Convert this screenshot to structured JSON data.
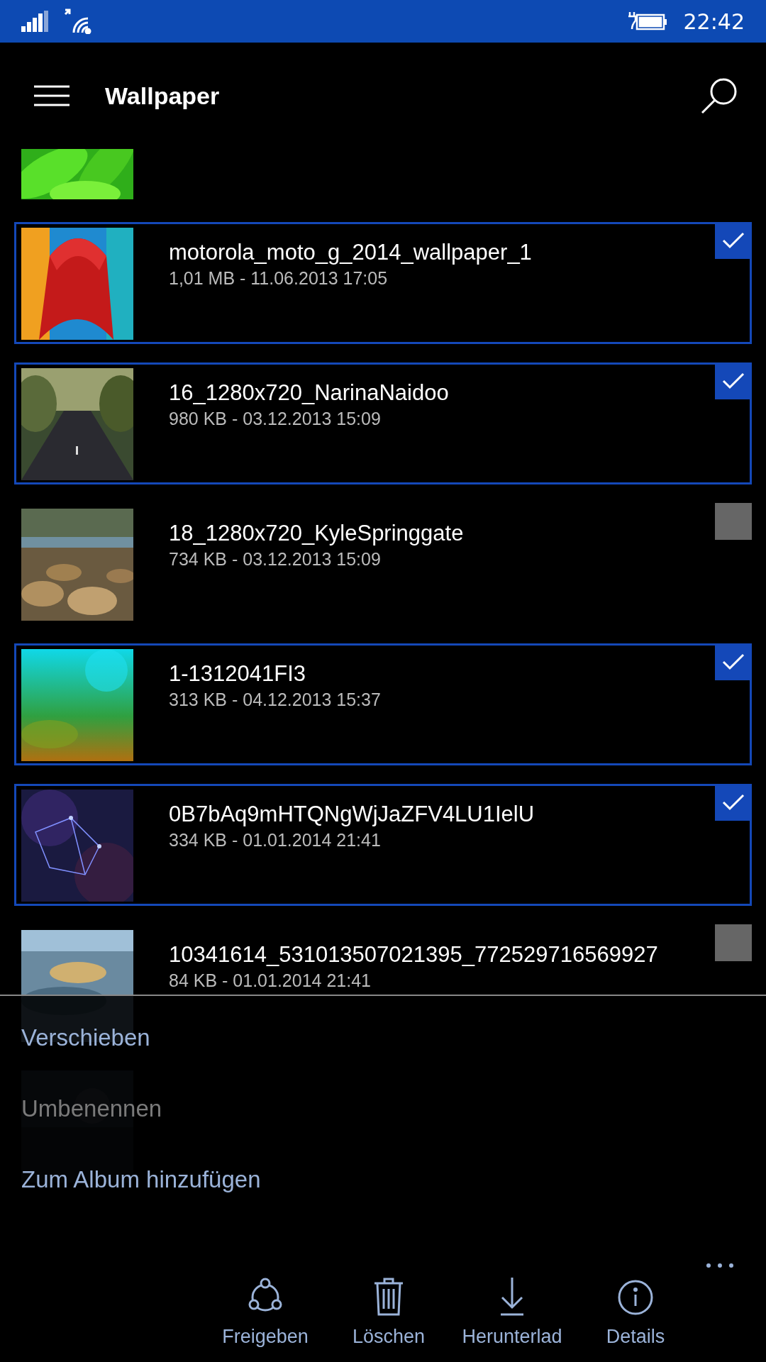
{
  "status_bar": {
    "time": "22:42"
  },
  "header": {
    "title": "Wallpaper"
  },
  "files": [
    {
      "kind": "partial"
    },
    {
      "kind": "file",
      "name": "motorola_moto_g_2014_wallpaper_1",
      "meta": "1,01 MB - 11.06.2013 17:05",
      "selected": true
    },
    {
      "kind": "file",
      "name": "16_1280x720_NarinaNaidoo",
      "meta": "980 KB - 03.12.2013 15:09",
      "selected": true
    },
    {
      "kind": "file",
      "name": "18_1280x720_KyleSpringgate",
      "meta": "734 KB - 03.12.2013 15:09",
      "selected": false
    },
    {
      "kind": "file",
      "name": "1-1312041FI3",
      "meta": "313 KB - 04.12.2013 15:37",
      "selected": true
    },
    {
      "kind": "file",
      "name": "0B7bAq9mHTQNgWjJaZFV4LU1IelU",
      "meta": "334 KB - 01.01.2014 21:41",
      "selected": true
    },
    {
      "kind": "file",
      "name": "10341614_531013507021395_772529716569927",
      "meta": "84 KB - 01.01.2014 21:41",
      "selected": false
    },
    {
      "kind": "partial"
    }
  ],
  "menu": [
    {
      "label": "Verschieben",
      "disabled": false
    },
    {
      "label": "Umbenennen",
      "disabled": true
    },
    {
      "label": "Zum Album hinzufügen",
      "disabled": false
    }
  ],
  "app_bar": [
    {
      "kind": "share",
      "label": "Freigeben"
    },
    {
      "kind": "delete",
      "label": "Löschen"
    },
    {
      "kind": "download",
      "label": "Herunterlad"
    },
    {
      "kind": "details",
      "label": "Details"
    }
  ]
}
